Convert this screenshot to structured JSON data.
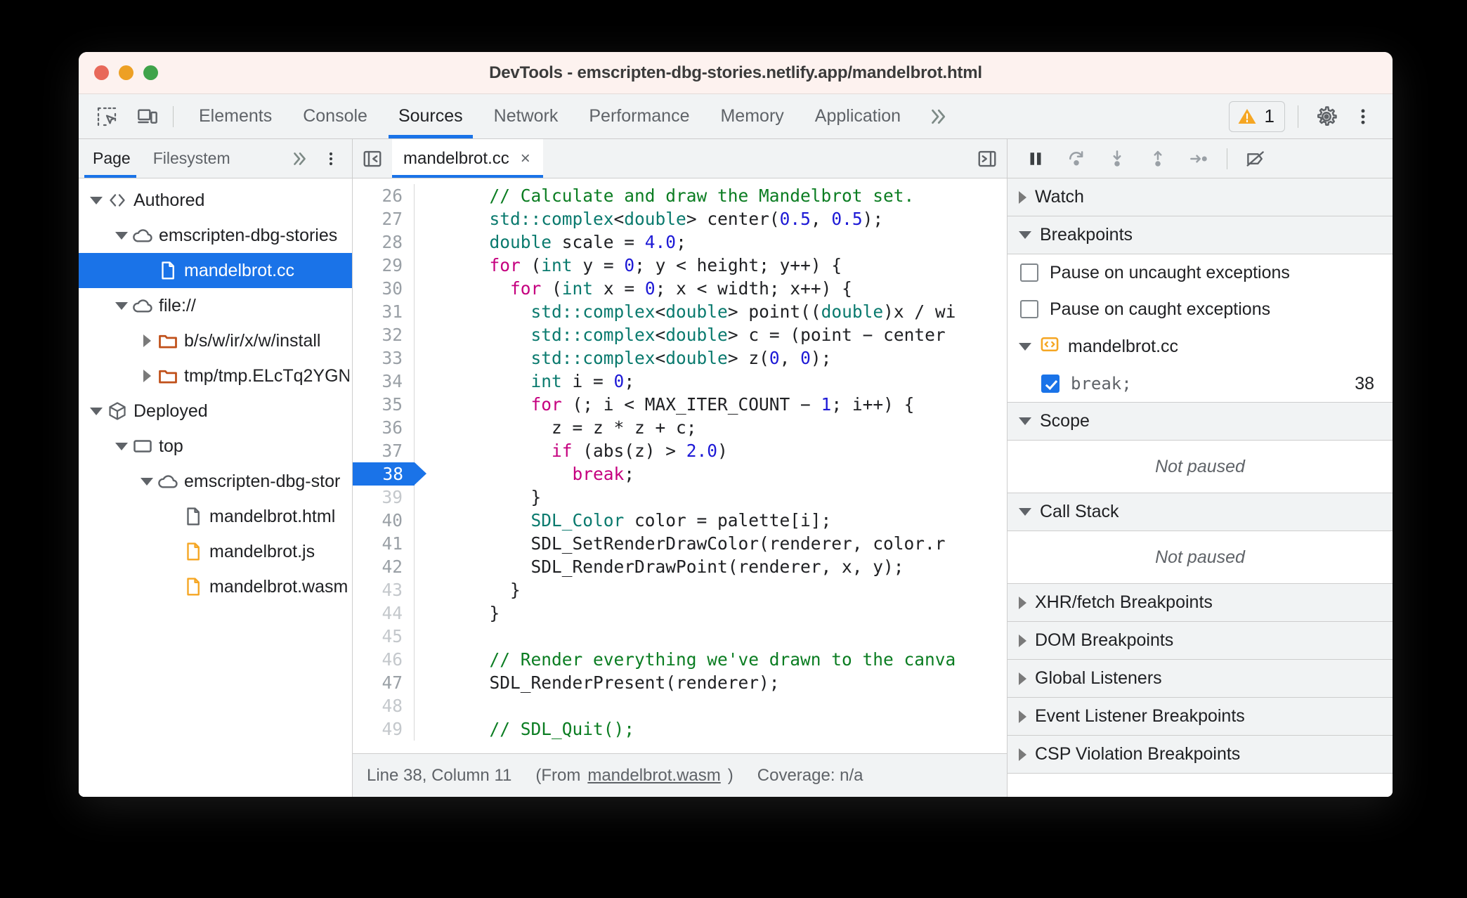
{
  "window": {
    "title": "DevTools - emscripten-dbg-stories.netlify.app/mandelbrot.html"
  },
  "toolbar": {
    "inspect_icon": "inspect-element-icon",
    "device_icon": "device-toolbar-icon",
    "tabs": [
      {
        "label": "Elements",
        "active": false
      },
      {
        "label": "Console",
        "active": false
      },
      {
        "label": "Sources",
        "active": true
      },
      {
        "label": "Network",
        "active": false
      },
      {
        "label": "Performance",
        "active": false
      },
      {
        "label": "Memory",
        "active": false
      },
      {
        "label": "Application",
        "active": false
      }
    ],
    "more_tabs": "»",
    "warning_count": "1",
    "settings_icon": "gear-icon",
    "menu_icon": "kebab-menu-icon"
  },
  "navigator": {
    "tabs": [
      {
        "label": "Page",
        "active": true
      },
      {
        "label": "Filesystem",
        "active": false
      }
    ],
    "more": "»",
    "tree": [
      {
        "label": "Authored",
        "indent": 0,
        "twisty": "down",
        "icon": "code-brackets-icon",
        "selected": false
      },
      {
        "label": "emscripten-dbg-stories",
        "indent": 1,
        "twisty": "down",
        "icon": "cloud-icon",
        "selected": false
      },
      {
        "label": "mandelbrot.cc",
        "indent": 2,
        "twisty": "none",
        "icon": "file-white-icon",
        "selected": true
      },
      {
        "label": "file://",
        "indent": 1,
        "twisty": "down",
        "icon": "cloud-icon",
        "selected": false
      },
      {
        "label": "b/s/w/ir/x/w/install",
        "indent": 2,
        "twisty": "right",
        "icon": "folder-orange-icon",
        "selected": false
      },
      {
        "label": "tmp/tmp.ELcTq2YGN",
        "indent": 2,
        "twisty": "right",
        "icon": "folder-orange-icon",
        "selected": false
      },
      {
        "label": "Deployed",
        "indent": 0,
        "twisty": "down",
        "icon": "cube-icon",
        "selected": false
      },
      {
        "label": "top",
        "indent": 1,
        "twisty": "down",
        "icon": "frame-icon",
        "selected": false
      },
      {
        "label": "emscripten-dbg-stor",
        "indent": 2,
        "twisty": "down",
        "icon": "cloud-icon",
        "selected": false
      },
      {
        "label": "mandelbrot.html",
        "indent": 3,
        "twisty": "none",
        "icon": "file-gray-icon",
        "selected": false
      },
      {
        "label": "mandelbrot.js",
        "indent": 3,
        "twisty": "none",
        "icon": "file-orange-icon",
        "selected": false
      },
      {
        "label": "mandelbrot.wasm",
        "indent": 3,
        "twisty": "none",
        "icon": "file-orange-icon",
        "selected": false
      }
    ]
  },
  "editor": {
    "collapse_left_icon": "panel-collapse-left-icon",
    "collapse_right_icon": "panel-collapse-right-icon",
    "tab_label": "mandelbrot.cc",
    "tab_close": "×",
    "lines": [
      {
        "n": "26",
        "dim": false,
        "bp": false,
        "tokens": [
          {
            "t": "      ",
            "c": "cp"
          },
          {
            "t": "// Calculate and draw the Mandelbrot set.",
            "c": "cm"
          }
        ]
      },
      {
        "n": "27",
        "dim": false,
        "bp": false,
        "tokens": [
          {
            "t": "      ",
            "c": "cp"
          },
          {
            "t": "std::complex",
            "c": "ct"
          },
          {
            "t": "<",
            "c": "cp"
          },
          {
            "t": "double",
            "c": "ct"
          },
          {
            "t": "> center(",
            "c": "cp"
          },
          {
            "t": "0.5",
            "c": "cn"
          },
          {
            "t": ", ",
            "c": "cp"
          },
          {
            "t": "0.5",
            "c": "cn"
          },
          {
            "t": ");",
            "c": "cp"
          }
        ]
      },
      {
        "n": "28",
        "dim": false,
        "bp": false,
        "tokens": [
          {
            "t": "      ",
            "c": "cp"
          },
          {
            "t": "double",
            "c": "ct"
          },
          {
            "t": " scale = ",
            "c": "cp"
          },
          {
            "t": "4.0",
            "c": "cn"
          },
          {
            "t": ";",
            "c": "cp"
          }
        ]
      },
      {
        "n": "29",
        "dim": false,
        "bp": false,
        "tokens": [
          {
            "t": "      ",
            "c": "cp"
          },
          {
            "t": "for",
            "c": "ck"
          },
          {
            "t": " (",
            "c": "cp"
          },
          {
            "t": "int",
            "c": "ct"
          },
          {
            "t": " y = ",
            "c": "cp"
          },
          {
            "t": "0",
            "c": "cn"
          },
          {
            "t": "; y < height; y++) {",
            "c": "cp"
          }
        ]
      },
      {
        "n": "30",
        "dim": false,
        "bp": false,
        "tokens": [
          {
            "t": "        ",
            "c": "cp"
          },
          {
            "t": "for",
            "c": "ck"
          },
          {
            "t": " (",
            "c": "cp"
          },
          {
            "t": "int",
            "c": "ct"
          },
          {
            "t": " x = ",
            "c": "cp"
          },
          {
            "t": "0",
            "c": "cn"
          },
          {
            "t": "; x < width; x++) {",
            "c": "cp"
          }
        ]
      },
      {
        "n": "31",
        "dim": false,
        "bp": false,
        "tokens": [
          {
            "t": "          ",
            "c": "cp"
          },
          {
            "t": "std::complex",
            "c": "ct"
          },
          {
            "t": "<",
            "c": "cp"
          },
          {
            "t": "double",
            "c": "ct"
          },
          {
            "t": "> point((",
            "c": "cp"
          },
          {
            "t": "double",
            "c": "ct"
          },
          {
            "t": ")x / wi",
            "c": "cp"
          }
        ]
      },
      {
        "n": "32",
        "dim": false,
        "bp": false,
        "tokens": [
          {
            "t": "          ",
            "c": "cp"
          },
          {
            "t": "std::complex",
            "c": "ct"
          },
          {
            "t": "<",
            "c": "cp"
          },
          {
            "t": "double",
            "c": "ct"
          },
          {
            "t": "> c = (point − center",
            "c": "cp"
          }
        ]
      },
      {
        "n": "33",
        "dim": false,
        "bp": false,
        "tokens": [
          {
            "t": "          ",
            "c": "cp"
          },
          {
            "t": "std::complex",
            "c": "ct"
          },
          {
            "t": "<",
            "c": "cp"
          },
          {
            "t": "double",
            "c": "ct"
          },
          {
            "t": "> z(",
            "c": "cp"
          },
          {
            "t": "0",
            "c": "cn"
          },
          {
            "t": ", ",
            "c": "cp"
          },
          {
            "t": "0",
            "c": "cn"
          },
          {
            "t": ");",
            "c": "cp"
          }
        ]
      },
      {
        "n": "34",
        "dim": false,
        "bp": false,
        "tokens": [
          {
            "t": "          ",
            "c": "cp"
          },
          {
            "t": "int",
            "c": "ct"
          },
          {
            "t": " i = ",
            "c": "cp"
          },
          {
            "t": "0",
            "c": "cn"
          },
          {
            "t": ";",
            "c": "cp"
          }
        ]
      },
      {
        "n": "35",
        "dim": false,
        "bp": false,
        "tokens": [
          {
            "t": "          ",
            "c": "cp"
          },
          {
            "t": "for",
            "c": "ck"
          },
          {
            "t": " (; i < MAX_ITER_COUNT − ",
            "c": "cp"
          },
          {
            "t": "1",
            "c": "cn"
          },
          {
            "t": "; i++) {",
            "c": "cp"
          }
        ]
      },
      {
        "n": "36",
        "dim": false,
        "bp": false,
        "tokens": [
          {
            "t": "            z = z * z + c;",
            "c": "cp"
          }
        ]
      },
      {
        "n": "37",
        "dim": false,
        "bp": false,
        "tokens": [
          {
            "t": "            ",
            "c": "cp"
          },
          {
            "t": "if",
            "c": "ck"
          },
          {
            "t": " (abs(z) > ",
            "c": "cp"
          },
          {
            "t": "2.0",
            "c": "cn"
          },
          {
            "t": ")",
            "c": "cp"
          }
        ]
      },
      {
        "n": "38",
        "dim": false,
        "bp": true,
        "tokens": [
          {
            "t": "              ",
            "c": "cp"
          },
          {
            "t": "break",
            "c": "ck"
          },
          {
            "t": ";",
            "c": "cp"
          }
        ]
      },
      {
        "n": "39",
        "dim": true,
        "bp": false,
        "tokens": [
          {
            "t": "          }",
            "c": "cp"
          }
        ]
      },
      {
        "n": "40",
        "dim": false,
        "bp": false,
        "tokens": [
          {
            "t": "          ",
            "c": "cp"
          },
          {
            "t": "SDL_Color",
            "c": "ct"
          },
          {
            "t": " color = palette[i];",
            "c": "cp"
          }
        ]
      },
      {
        "n": "41",
        "dim": false,
        "bp": false,
        "tokens": [
          {
            "t": "          SDL_SetRenderDrawColor(renderer, color.r",
            "c": "cp"
          }
        ]
      },
      {
        "n": "42",
        "dim": false,
        "bp": false,
        "tokens": [
          {
            "t": "          SDL_RenderDrawPoint(renderer, x, y);",
            "c": "cp"
          }
        ]
      },
      {
        "n": "43",
        "dim": true,
        "bp": false,
        "tokens": [
          {
            "t": "        }",
            "c": "cp"
          }
        ]
      },
      {
        "n": "44",
        "dim": true,
        "bp": false,
        "tokens": [
          {
            "t": "      }",
            "c": "cp"
          }
        ]
      },
      {
        "n": "45",
        "dim": true,
        "bp": false,
        "tokens": [
          {
            "t": "",
            "c": "cp"
          }
        ]
      },
      {
        "n": "46",
        "dim": true,
        "bp": false,
        "tokens": [
          {
            "t": "      ",
            "c": "cp"
          },
          {
            "t": "// Render everything we've drawn to the canva",
            "c": "cm"
          }
        ]
      },
      {
        "n": "47",
        "dim": false,
        "bp": false,
        "tokens": [
          {
            "t": "      SDL_RenderPresent(renderer);",
            "c": "cp"
          }
        ]
      },
      {
        "n": "48",
        "dim": true,
        "bp": false,
        "tokens": [
          {
            "t": "",
            "c": "cp"
          }
        ]
      },
      {
        "n": "49",
        "dim": true,
        "bp": false,
        "tokens": [
          {
            "t": "      ",
            "c": "cp"
          },
          {
            "t": "// SDL_Quit();",
            "c": "cm"
          }
        ]
      }
    ],
    "status": {
      "position": "Line 38, Column 11",
      "from_prefix": "(From ",
      "from_link": "mandelbrot.wasm",
      "from_suffix": ")",
      "coverage": "Coverage: n/a"
    }
  },
  "debugger": {
    "controls": [
      {
        "name": "resume-pause-button",
        "glyph": "pause"
      },
      {
        "name": "step-over-button",
        "glyph": "step-over"
      },
      {
        "name": "step-into-button",
        "glyph": "step-into"
      },
      {
        "name": "step-out-button",
        "glyph": "step-out"
      },
      {
        "name": "step-button",
        "glyph": "step"
      },
      {
        "name": "deactivate-breakpoints-button",
        "glyph": "deactivate"
      }
    ],
    "sections": {
      "watch": {
        "label": "Watch",
        "expanded": false
      },
      "breakpoints": {
        "label": "Breakpoints",
        "expanded": true,
        "pause_uncaught": {
          "label": "Pause on uncaught exceptions",
          "checked": false
        },
        "pause_caught": {
          "label": "Pause on caught exceptions",
          "checked": false
        },
        "file": {
          "label": "mandelbrot.cc",
          "icon": "source-mapped-icon"
        },
        "items": [
          {
            "code": "break;",
            "line": "38",
            "checked": true
          }
        ]
      },
      "scope": {
        "label": "Scope",
        "expanded": true,
        "empty_text": "Not paused"
      },
      "call_stack": {
        "label": "Call Stack",
        "expanded": true,
        "empty_text": "Not paused"
      },
      "collapsed": [
        {
          "label": "XHR/fetch Breakpoints"
        },
        {
          "label": "DOM Breakpoints"
        },
        {
          "label": "Global Listeners"
        },
        {
          "label": "Event Listener Breakpoints"
        },
        {
          "label": "CSP Violation Breakpoints"
        }
      ]
    }
  },
  "colors": {
    "accent": "#1a73e8",
    "warning": "#f5a623",
    "toolbar_bg": "#f1f3f4",
    "titlebar_bg": "#fdf2ef"
  }
}
